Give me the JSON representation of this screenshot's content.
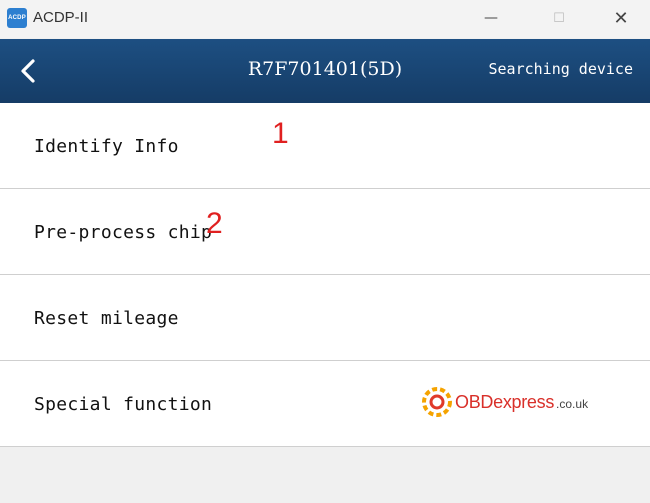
{
  "window": {
    "app_icon_text": "ACDP",
    "title": "ACDP-II",
    "minimize_glyph": "—",
    "maximize_glyph": "☐",
    "close_glyph": "✕"
  },
  "header": {
    "back_icon": "chevron-left-icon",
    "title": "R7F701401(5D)",
    "status": "Searching device",
    "background_color": "#1a4675"
  },
  "menu": {
    "items": [
      {
        "label": "Identify Info"
      },
      {
        "label": "Pre-process chip"
      },
      {
        "label": "Reset mileage"
      },
      {
        "label": "Special function"
      }
    ]
  },
  "annotations": {
    "one": "1",
    "two": "2",
    "color": "#e02020"
  },
  "watermark": {
    "brand": "OBDexpress",
    "suffix": ".co.uk"
  }
}
